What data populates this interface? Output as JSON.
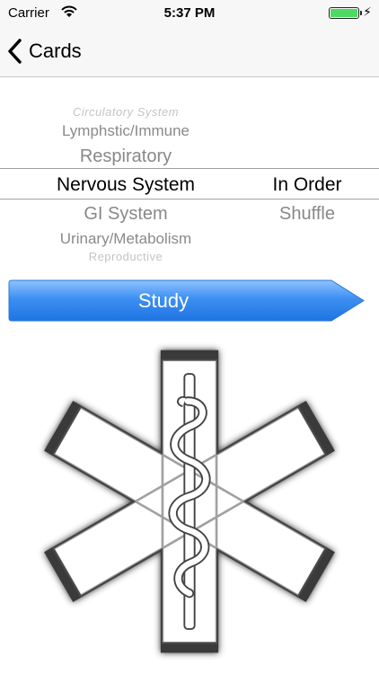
{
  "status_bar": {
    "carrier": "Carrier",
    "time": "5:37 PM",
    "battery_color": "#4cd964"
  },
  "nav": {
    "back_label": "Cards"
  },
  "picker": {
    "categories": [
      "Circulatory System",
      "Lymphstic/Immune",
      "Respiratory",
      "Nervous System",
      "GI System",
      "Urinary/Metabolism",
      "Reproductive"
    ],
    "selected_category": "Nervous System",
    "orders": [
      "In Order",
      "Shuffle"
    ],
    "selected_order": "In Order"
  },
  "study_button": {
    "label": "Study",
    "color": "#3d8ff2"
  },
  "logo": {
    "icon": "star-of-life-icon"
  }
}
